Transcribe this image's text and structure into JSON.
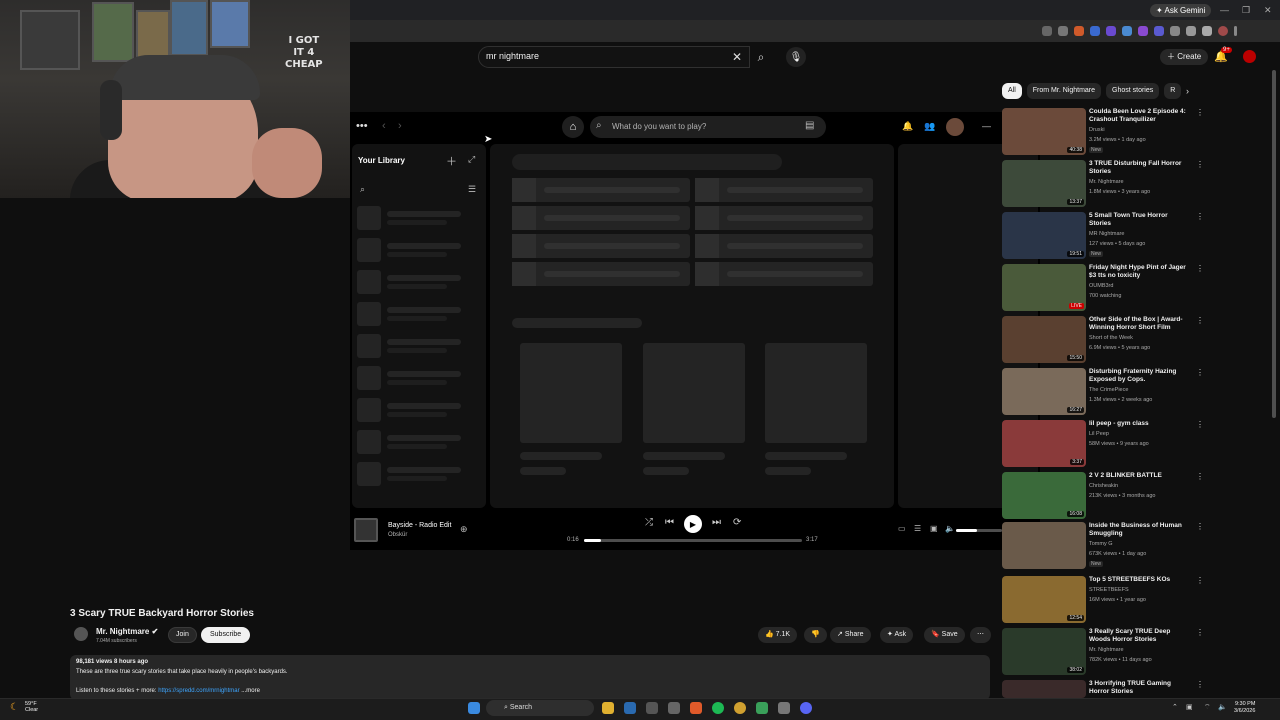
{
  "browser": {
    "gemini_label": "✦ Ask Gemini"
  },
  "youtube": {
    "search_value": "mr nightmare",
    "create_label": "Create",
    "notification_count": "9+",
    "chips": [
      "All",
      "From Mr. Nightmare",
      "Ghost stories",
      "R"
    ],
    "video": {
      "title": "3 Scary TRUE Backyard Horror Stories",
      "channel": "Mr. Nightmare",
      "subscribers": "7.04M subscribers",
      "join_label": "Join",
      "subscribe_label": "Subscribe",
      "likes": "7.1K",
      "share_label": "Share",
      "ask_label": "Ask",
      "save_label": "Save",
      "views_date": "98,181 views  8 hours ago",
      "description": "These are three true scary stories that take place heavily in people's backyards.",
      "listen_text": "Listen to these stories + more:",
      "listen_link": "https://spredd.com/mrnightmar",
      "more_label": "...more"
    },
    "recommendations": [
      {
        "title": "Coulda Been Love 2 Episode 4: Crashout Tranquilizer",
        "channel": "Druski",
        "meta": "3.2M views • 1 day ago",
        "duration": "40:38",
        "badge": "New",
        "thumb": "#6b4a3a"
      },
      {
        "title": "3 TRUE Disturbing Fall Horror Stories",
        "channel": "Mr. Nightmare",
        "meta": "1.8M views • 3 years ago",
        "duration": "13:37",
        "badge": "",
        "thumb": "#3d4a3a"
      },
      {
        "title": "5 Small Town True Horror Stories",
        "channel": "MR Nightmare",
        "meta": "127 views • 5 days ago",
        "duration": "19:51",
        "badge": "New",
        "thumb": "#2a3548"
      },
      {
        "title": "Friday Night Hype Pint of Jager $3 tts no toxicity",
        "channel": "OUMB3rd",
        "meta": "700 watching",
        "duration": "LIVE",
        "badge": "",
        "thumb": "#4a5a3a"
      },
      {
        "title": "Other Side of the Box | Award-Winning Horror Short Film",
        "channel": "Short of the Week",
        "meta": "6.9M views • 5 years ago",
        "duration": "15:50",
        "badge": "",
        "thumb": "#5a4030"
      },
      {
        "title": "Disturbing Fraternity Hazing Exposed by Cops.",
        "channel": "The CrimePiece",
        "meta": "1.3M views • 2 weeks ago",
        "duration": "16:27",
        "badge": "",
        "thumb": "#7a6a5a"
      },
      {
        "title": "lil peep - gym class",
        "channel": "Lil Peep",
        "meta": "58M views • 9 years ago",
        "duration": "3:37",
        "badge": "",
        "thumb": "#8a3a3a"
      },
      {
        "title": "2 V 2 BLINKER BATTLE",
        "channel": "Chrisheakin",
        "meta": "213K views • 3 months ago",
        "duration": "16:08",
        "badge": "",
        "thumb": "#3a6a3a"
      },
      {
        "title": "Inside the Business of Human Smuggling",
        "channel": "Tommy G",
        "meta": "673K views • 1 day ago",
        "duration": "",
        "badge": "New",
        "thumb": "#6a5a4a"
      },
      {
        "title": "Top 5 STREETBEEFS KOs",
        "channel": "STREETBEEFS",
        "meta": "16M views • 1 year ago",
        "duration": "12:54",
        "badge": "",
        "thumb": "#8a6a30"
      },
      {
        "title": "3 Really Scary TRUE Deep Woods Horror Stories",
        "channel": "Mr. Nightmare",
        "meta": "782K views • 11 days ago",
        "duration": "38:02",
        "badge": "",
        "thumb": "#2a3a2a"
      },
      {
        "title": "3 Horrifying TRUE Gaming Horror Stories",
        "channel": "",
        "meta": "",
        "duration": "",
        "badge": "",
        "thumb": "#3a2a2a"
      }
    ]
  },
  "spotify": {
    "search_placeholder": "What do you want to play?",
    "library_title": "Your Library",
    "track": "Bayside - Radio Edit",
    "artist": "Obskür",
    "elapsed": "0:16",
    "duration": "3:17",
    "progress": 0.08,
    "volume": 0.45
  },
  "webcam": {
    "shirt_text_1": "I GOT",
    "shirt_text_2": "IT 4",
    "shirt_text_3": "CHEAP"
  },
  "taskbar": {
    "temp": "59°F",
    "weather": "Clear",
    "search": "Search",
    "time": "9:30 PM",
    "date": "3/6/2026"
  }
}
